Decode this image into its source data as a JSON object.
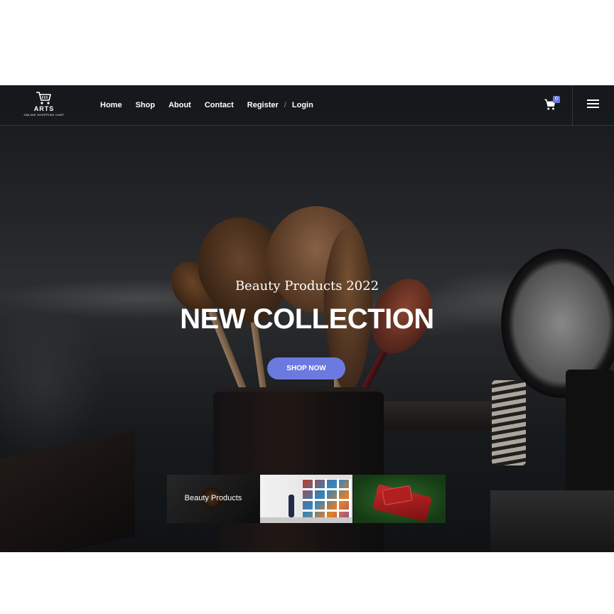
{
  "header": {
    "logo": {
      "title": "ARTS",
      "subtitle": "ONLINE SHOPPING CART",
      "icon": "shopping-cart-icon"
    },
    "nav": [
      {
        "label": "Home"
      },
      {
        "label": "Shop"
      },
      {
        "label": "About"
      },
      {
        "label": "Contact"
      },
      {
        "label": "Register"
      },
      {
        "label": "Login"
      }
    ],
    "nav_separator": "/",
    "cart": {
      "icon": "cart-icon",
      "count": "0"
    },
    "menu_icon": "hamburger-menu-icon"
  },
  "hero": {
    "subtitle": "Beauty Products 2022",
    "headline": "NEW COLLECTION",
    "cta_label": "SHOP NOW"
  },
  "thumbnails": [
    {
      "label": "Beauty Products"
    },
    {
      "label": ""
    },
    {
      "label": ""
    }
  ],
  "colors": {
    "accent": "#6c7ae0",
    "text": "#ffffff",
    "background_dark": "#1b1f22"
  }
}
